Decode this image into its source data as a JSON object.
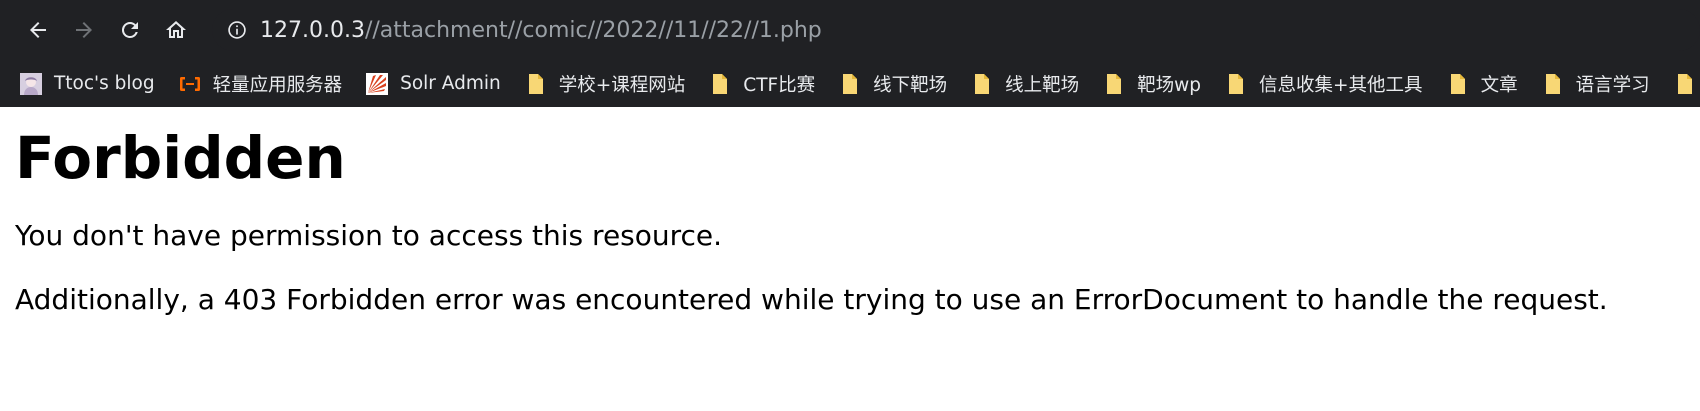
{
  "browser": {
    "nav": {
      "back_icon": "arrow-left-icon",
      "forward_icon": "arrow-right-icon",
      "reload_icon": "reload-icon",
      "home_icon": "home-icon"
    },
    "address_bar": {
      "host": "127.0.0.3",
      "path": "//attachment//comic//2022//11//22//1.php",
      "security_icon": "info-circle-icon"
    },
    "bookmarks": [
      {
        "label": "Ttoc's blog",
        "icon": "avatar-favicon"
      },
      {
        "label": "轻量应用服务器",
        "icon": "aliyun-favicon"
      },
      {
        "label": "Solr Admin",
        "icon": "solr-favicon"
      },
      {
        "label": "学校+课程网站",
        "icon": "folder-icon"
      },
      {
        "label": "CTF比赛",
        "icon": "folder-icon"
      },
      {
        "label": "线下靶场",
        "icon": "folder-icon"
      },
      {
        "label": "线上靶场",
        "icon": "folder-icon"
      },
      {
        "label": "靶场wp",
        "icon": "folder-icon"
      },
      {
        "label": "信息收集+其他工具",
        "icon": "folder-icon"
      },
      {
        "label": "文章",
        "icon": "folder-icon"
      },
      {
        "label": "语言学习",
        "icon": "folder-icon"
      }
    ],
    "colors": {
      "chrome_bg": "#202124",
      "chrome_text": "#e8eaed",
      "url_path": "#9aa0a6",
      "folder": "#f8d775",
      "aliyun": "#ff6a00",
      "solr": "#d9411e"
    }
  },
  "page": {
    "heading": "Forbidden",
    "message": "You don't have permission to access this resource.",
    "detail": "Additionally, a 403 Forbidden error was encountered while trying to use an ErrorDocument to handle the request."
  }
}
